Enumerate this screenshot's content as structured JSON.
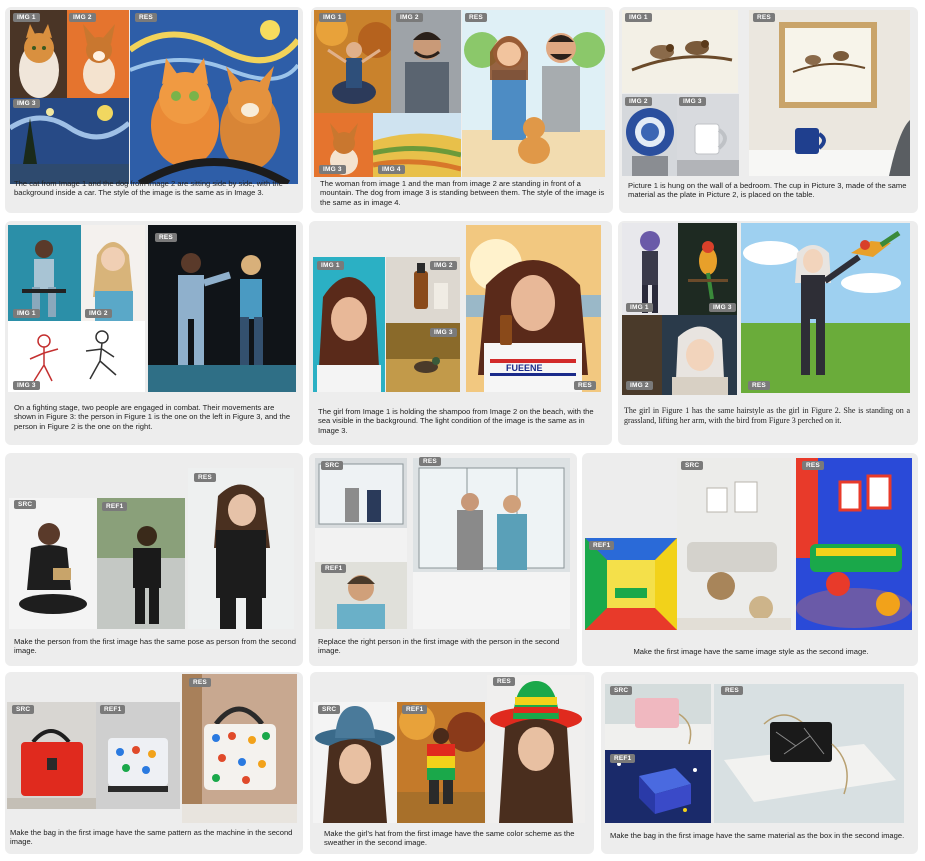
{
  "panels": [
    {
      "tags": [
        "IMG 1",
        "IMG 2",
        "IMG 3",
        "RES"
      ],
      "caption": "The cat from Image 1 and the dog from Image 2 are sitting side by side, with the background inside a car. The style of the image is the same as in Image 3."
    },
    {
      "tags": [
        "IMG 1",
        "IMG 2",
        "RES",
        "IMG 3",
        "IMG 4"
      ],
      "caption": "The woman from image 1 and the man from image 2 are standing in front of a mountain. The dog from image 3 is standing between them. The style of the image is the same as in image 4."
    },
    {
      "tags": [
        "IMG 1",
        "RES",
        "IMG 2",
        "IMG 3"
      ],
      "caption": "Picture 1 is hung on the wall of a bedroom. The cup in Picture 3, made of the same material as the plate in Picture 2, is placed on the table."
    },
    {
      "tags": [
        "RES",
        "IMG 1",
        "IMG 2",
        "IMG 3"
      ],
      "caption": "On a fighting stage, two people are engaged in combat. Their movements are shown in Figure 3: the person in Figure 1 is the one on the left in Figure 3, and the person in Figure 2 is the one on the right."
    },
    {
      "tags": [
        "IMG 1",
        "IMG 2",
        "IMG 3",
        "RES"
      ],
      "caption": "The girl from Image 1 is holding the shampoo from Image 2 on the beach, with the sea visible in the background. The light condition of the image is the same as in Image 3.",
      "shirt_text": "FUEENE"
    },
    {
      "tags": [
        "IMG 1",
        "IMG 3",
        "IMG 2",
        "RES"
      ],
      "caption": "The girl in Figure 1 has the same hairstyle as the girl in Figure 2. She is standing on a grassland, lifting her arm, with the bird from Figure 3 perched on it."
    },
    {
      "tags": [
        "SRC",
        "REF1",
        "RES"
      ],
      "caption": "Make the person from the first image has the same pose as person from the second image."
    },
    {
      "tags": [
        "SRC",
        "RES",
        "REF1"
      ],
      "caption": "Replace the right person in the first image with the person in the second image."
    },
    {
      "tags": [
        "REF1",
        "SRC",
        "RES"
      ],
      "caption": "Make the first image have the same image style as the second image."
    },
    {
      "tags": [
        "RES",
        "SRC",
        "REF1"
      ],
      "caption": "Make the bag in the first image have the same pattern as the machine in the second image."
    },
    {
      "tags": [
        "RES",
        "SRC",
        "REF1"
      ],
      "caption": "Make the girl's hat from the first image have the same color scheme as the sweather in the second image."
    },
    {
      "tags": [
        "SRC",
        "RES",
        "REF1"
      ],
      "caption": "Make the bag in the first image have the same material as the box in the second image."
    }
  ],
  "colors": {
    "card_bg": "#ededed",
    "tag_bg": "#7a7a7a",
    "caption": "#222222"
  }
}
